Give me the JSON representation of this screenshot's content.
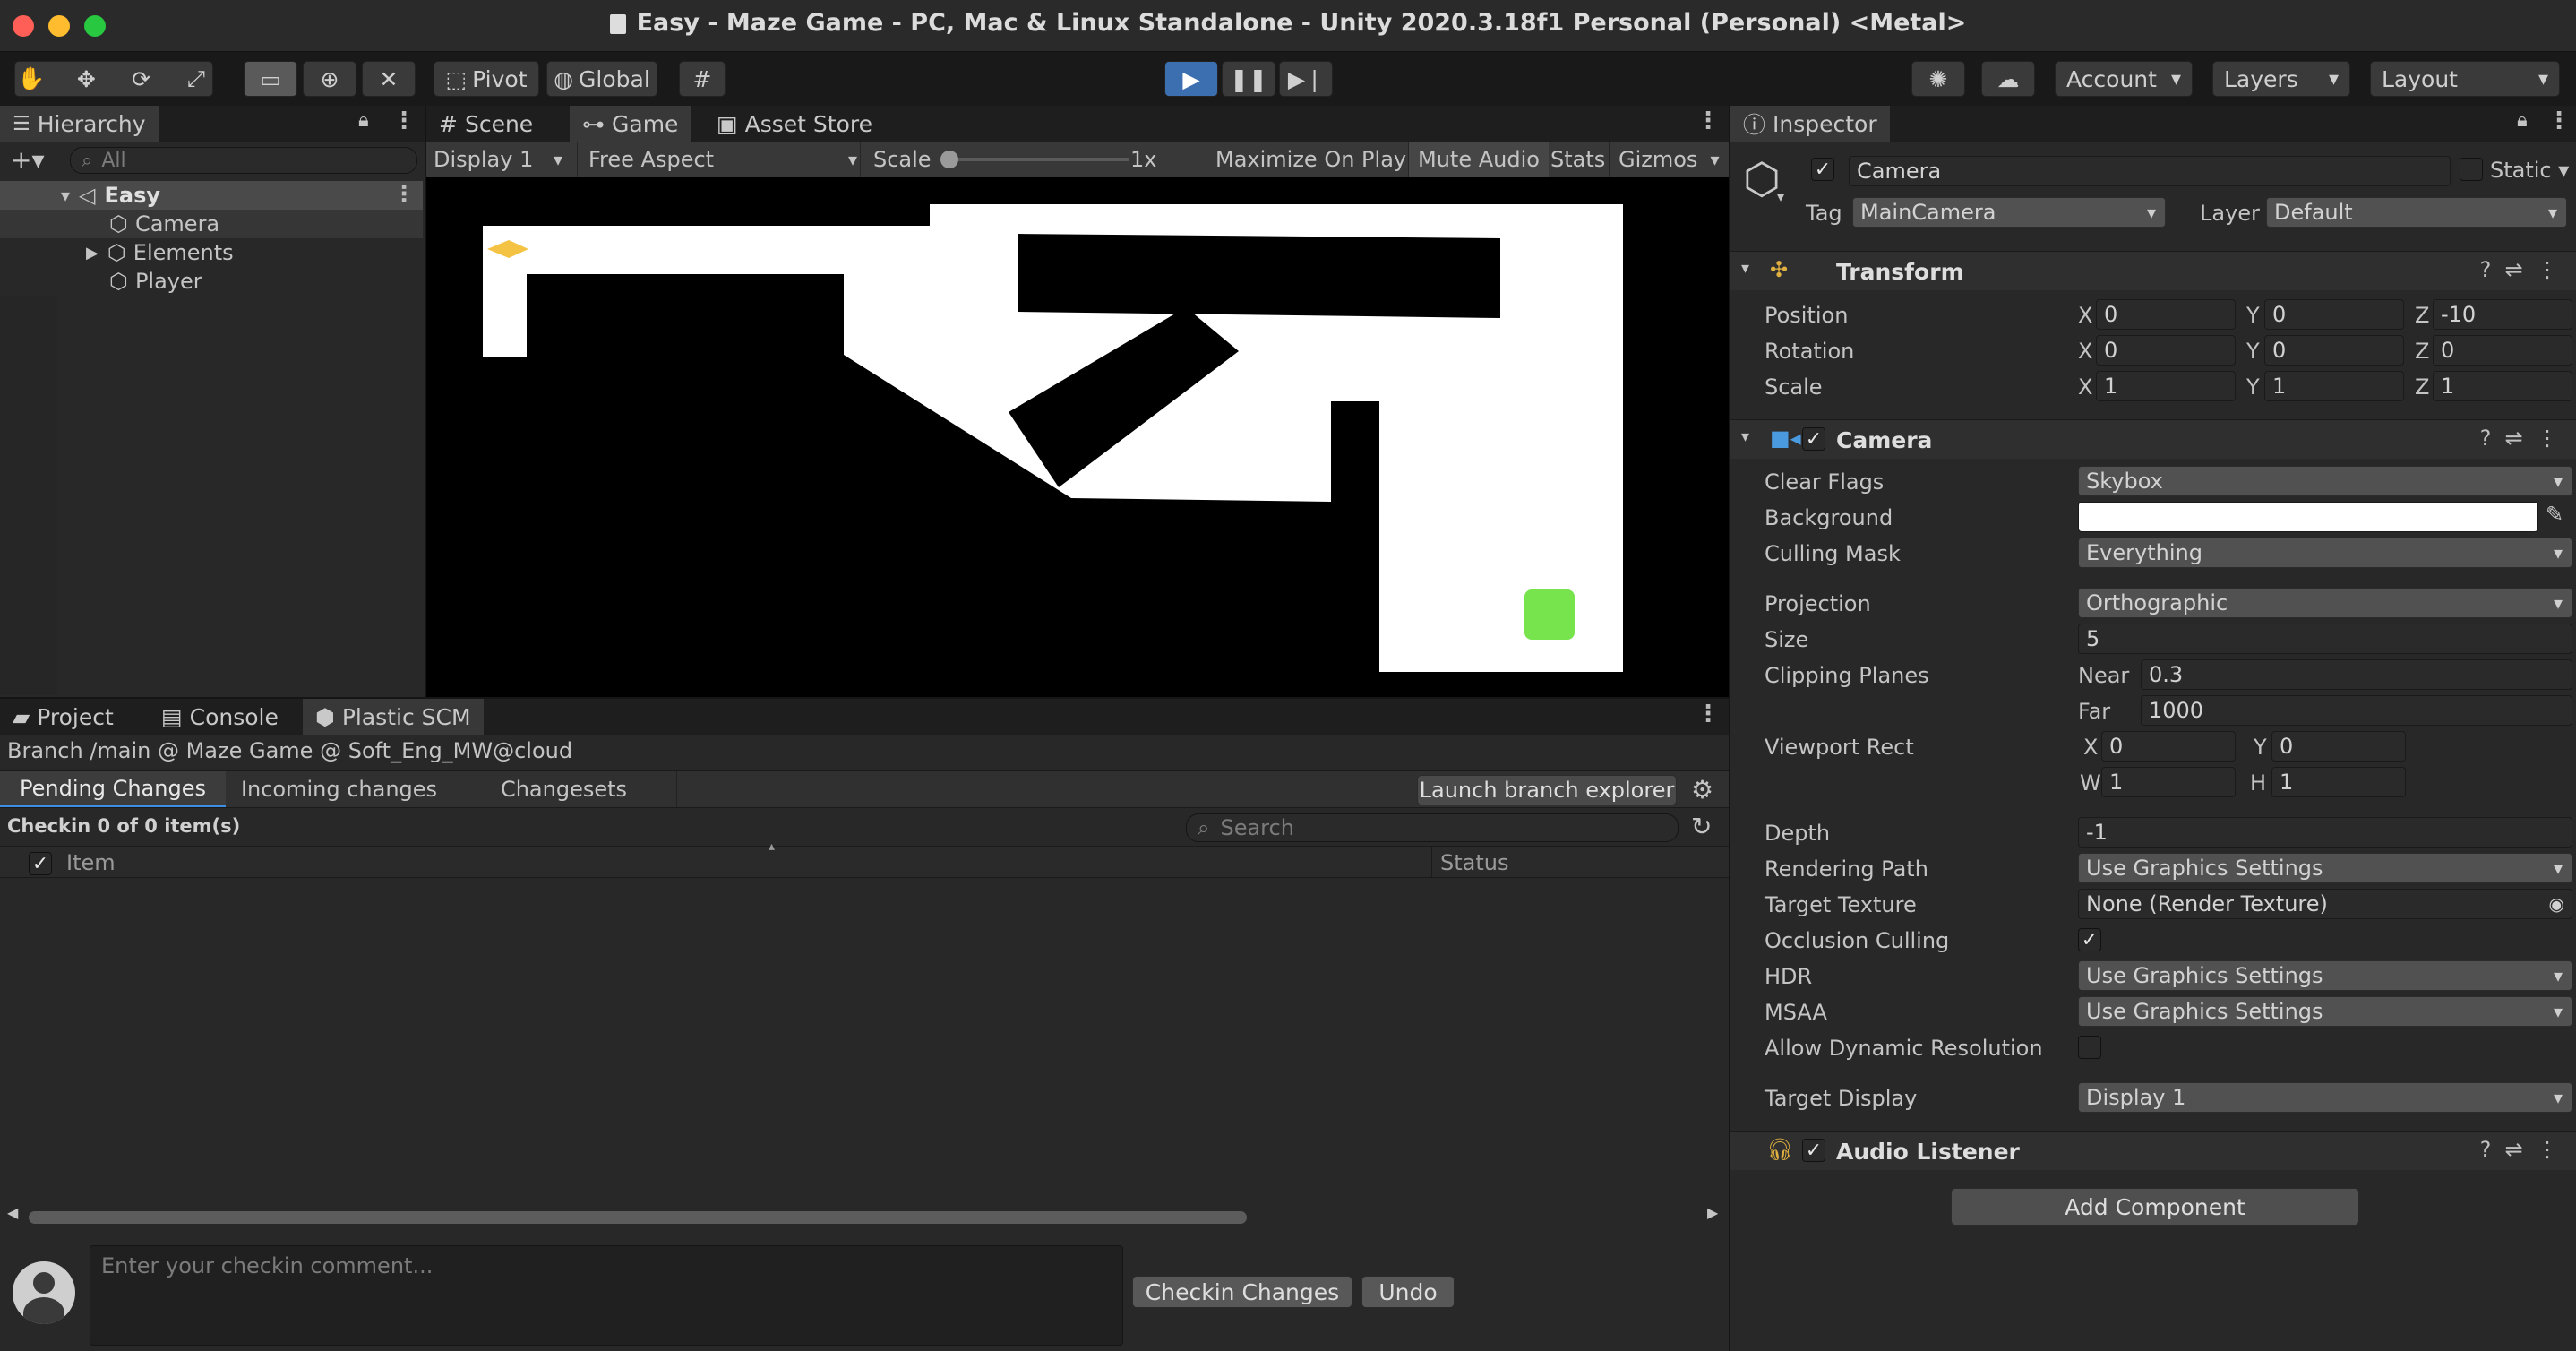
{
  "window": {
    "title": "Easy - Maze Game - PC, Mac & Linux Standalone - Unity 2020.3.18f1 Personal (Personal) <Metal>"
  },
  "toolbar": {
    "pivot": "Pivot",
    "global": "Global",
    "account": "Account",
    "layers": "Layers",
    "layout": "Layout"
  },
  "hierarchy": {
    "tab": "Hierarchy",
    "search_placeholder": "All",
    "scene": "Easy",
    "items": [
      "Camera",
      "Elements",
      "Player"
    ]
  },
  "center_tabs": [
    "Scene",
    "Game",
    "Asset Store"
  ],
  "game_toolbar": {
    "display": "Display 1",
    "aspect": "Free Aspect",
    "scale_label": "Scale",
    "scale_value": "1x",
    "maximize": "Maximize On Play",
    "mute": "Mute Audio",
    "stats": "Stats",
    "gizmos": "Gizmos",
    "scale_slider_fraction": 0.0
  },
  "bottom": {
    "tabs": [
      "Project",
      "Console",
      "Plastic SCM"
    ],
    "branch": "Branch /main @ Maze Game @ Soft_Eng_MW@cloud",
    "subtabs": [
      "Pending Changes",
      "Incoming changes",
      "Changesets"
    ],
    "launch": "Launch branch explorer",
    "checkin_count": "Checkin 0 of 0 item(s)",
    "search_placeholder": "Search",
    "col_item": "Item",
    "col_status": "Status",
    "comment_placeholder": "Enter your checkin comment...",
    "checkin_button": "Checkin Changes",
    "undo_button": "Undo"
  },
  "inspector": {
    "tab": "Inspector",
    "object_name": "Camera",
    "static_label": "Static",
    "tag_label": "Tag",
    "tag_value": "MainCamera",
    "layer_label": "Layer",
    "layer_value": "Default",
    "transform": {
      "title": "Transform",
      "rows": [
        {
          "label": "Position",
          "x": "0",
          "y": "0",
          "z": "-10"
        },
        {
          "label": "Rotation",
          "x": "0",
          "y": "0",
          "z": "0"
        },
        {
          "label": "Scale",
          "x": "1",
          "y": "1",
          "z": "1"
        }
      ]
    },
    "camera": {
      "title": "Camera",
      "clear_flags_label": "Clear Flags",
      "clear_flags": "Skybox",
      "background_label": "Background",
      "background_color": "#ffffff",
      "culling_mask_label": "Culling Mask",
      "culling_mask": "Everything",
      "projection_label": "Projection",
      "projection": "Orthographic",
      "size_label": "Size",
      "size": "5",
      "clipping_label": "Clipping Planes",
      "near_label": "Near",
      "near": "0.3",
      "far_label": "Far",
      "far": "1000",
      "viewport_label": "Viewport Rect",
      "vx": "0",
      "vy": "0",
      "vw": "1",
      "vh": "1",
      "depth_label": "Depth",
      "depth": "-1",
      "rendering_path_label": "Rendering Path",
      "rendering_path": "Use Graphics Settings",
      "target_texture_label": "Target Texture",
      "target_texture": "None (Render Texture)",
      "occlusion_label": "Occlusion Culling",
      "hdr_label": "HDR",
      "hdr": "Use Graphics Settings",
      "msaa_label": "MSAA",
      "msaa": "Use Graphics Settings",
      "dynamic_res_label": "Allow Dynamic Resolution",
      "target_display_label": "Target Display",
      "target_display": "Display 1"
    },
    "audio_listener": "Audio Listener",
    "add_component": "Add Component"
  },
  "colors": {
    "play_active": "#3c6fb0",
    "player": "#f5c343",
    "goal": "#77e34d"
  }
}
